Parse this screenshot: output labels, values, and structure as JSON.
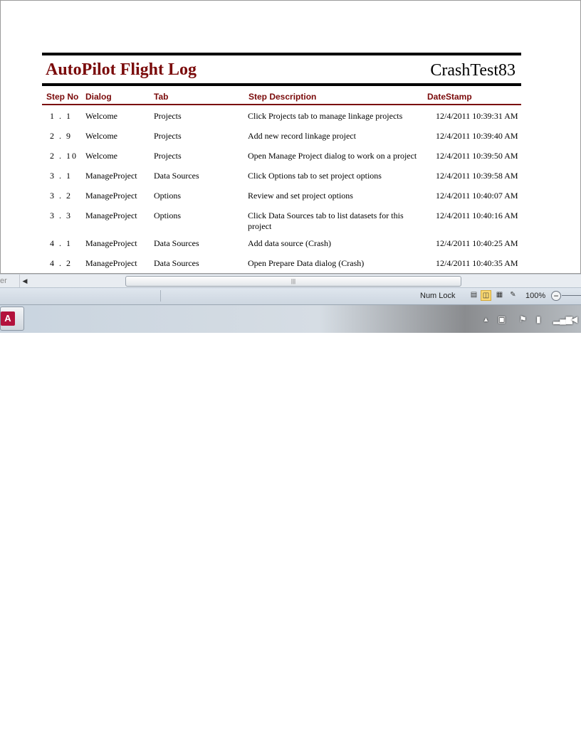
{
  "report": {
    "title": "AutoPilot Flight Log",
    "subtitle": "CrashTest83",
    "columns": [
      "Step No",
      "Dialog",
      "Tab",
      "Step Description",
      "DateStamp"
    ],
    "rows": [
      {
        "step": "1 . 1",
        "dialog": "Welcome",
        "tab": "Projects",
        "description": "Click Projects tab to manage linkage projects",
        "date": "12/4/2011 10:39:31 AM"
      },
      {
        "step": "2 . 9",
        "dialog": "Welcome",
        "tab": "Projects",
        "description": "Add new record linkage project",
        "date": "12/4/2011 10:39:40 AM"
      },
      {
        "step": "2 . 10",
        "dialog": "Welcome",
        "tab": "Projects",
        "description": "Open Manage Project dialog to work on a project",
        "date": "12/4/2011 10:39:50 AM"
      },
      {
        "step": "3 . 1",
        "dialog": "ManageProject",
        "tab": "Data Sources",
        "description": "Click Options tab to set project options",
        "date": "12/4/2011 10:39:58 AM"
      },
      {
        "step": "3 . 2",
        "dialog": "ManageProject",
        "tab": "Options",
        "description": "Review and set project options",
        "date": "12/4/2011 10:40:07 AM"
      },
      {
        "step": "3 . 3",
        "dialog": "ManageProject",
        "tab": "Options",
        "description": "Click Data Sources tab to list datasets for this project",
        "date": "12/4/2011 10:40:16 AM"
      },
      {
        "step": "4 . 1",
        "dialog": "ManageProject",
        "tab": "Data Sources",
        "description": "Add data source (Crash)",
        "date": "12/4/2011 10:40:25 AM"
      },
      {
        "step": "4 . 2",
        "dialog": "ManageProject",
        "tab": "Data Sources",
        "description": "Open Prepare Data dialog (Crash)",
        "date": "12/4/2011 10:40:35 AM"
      }
    ]
  },
  "scrollbar": {
    "left_cut_text": "er",
    "thumb_grip": "|||"
  },
  "statusbar": {
    "numlock": "Num Lock",
    "zoom": "100%",
    "zoom_out": "−"
  },
  "colors": {
    "title": "#7a0a0a",
    "accent_rule": "#7a0a0a",
    "active_view": "#fbd972"
  },
  "icons": {
    "view_buttons": [
      "report-view-icon",
      "print-preview-icon",
      "layout-view-icon",
      "design-view-icon"
    ],
    "tray": [
      "show-hidden-icons-icon",
      "network-icon",
      "action-center-flag-icon",
      "power-icon",
      "signal-bars-icon",
      "volume-muted-icon"
    ]
  }
}
